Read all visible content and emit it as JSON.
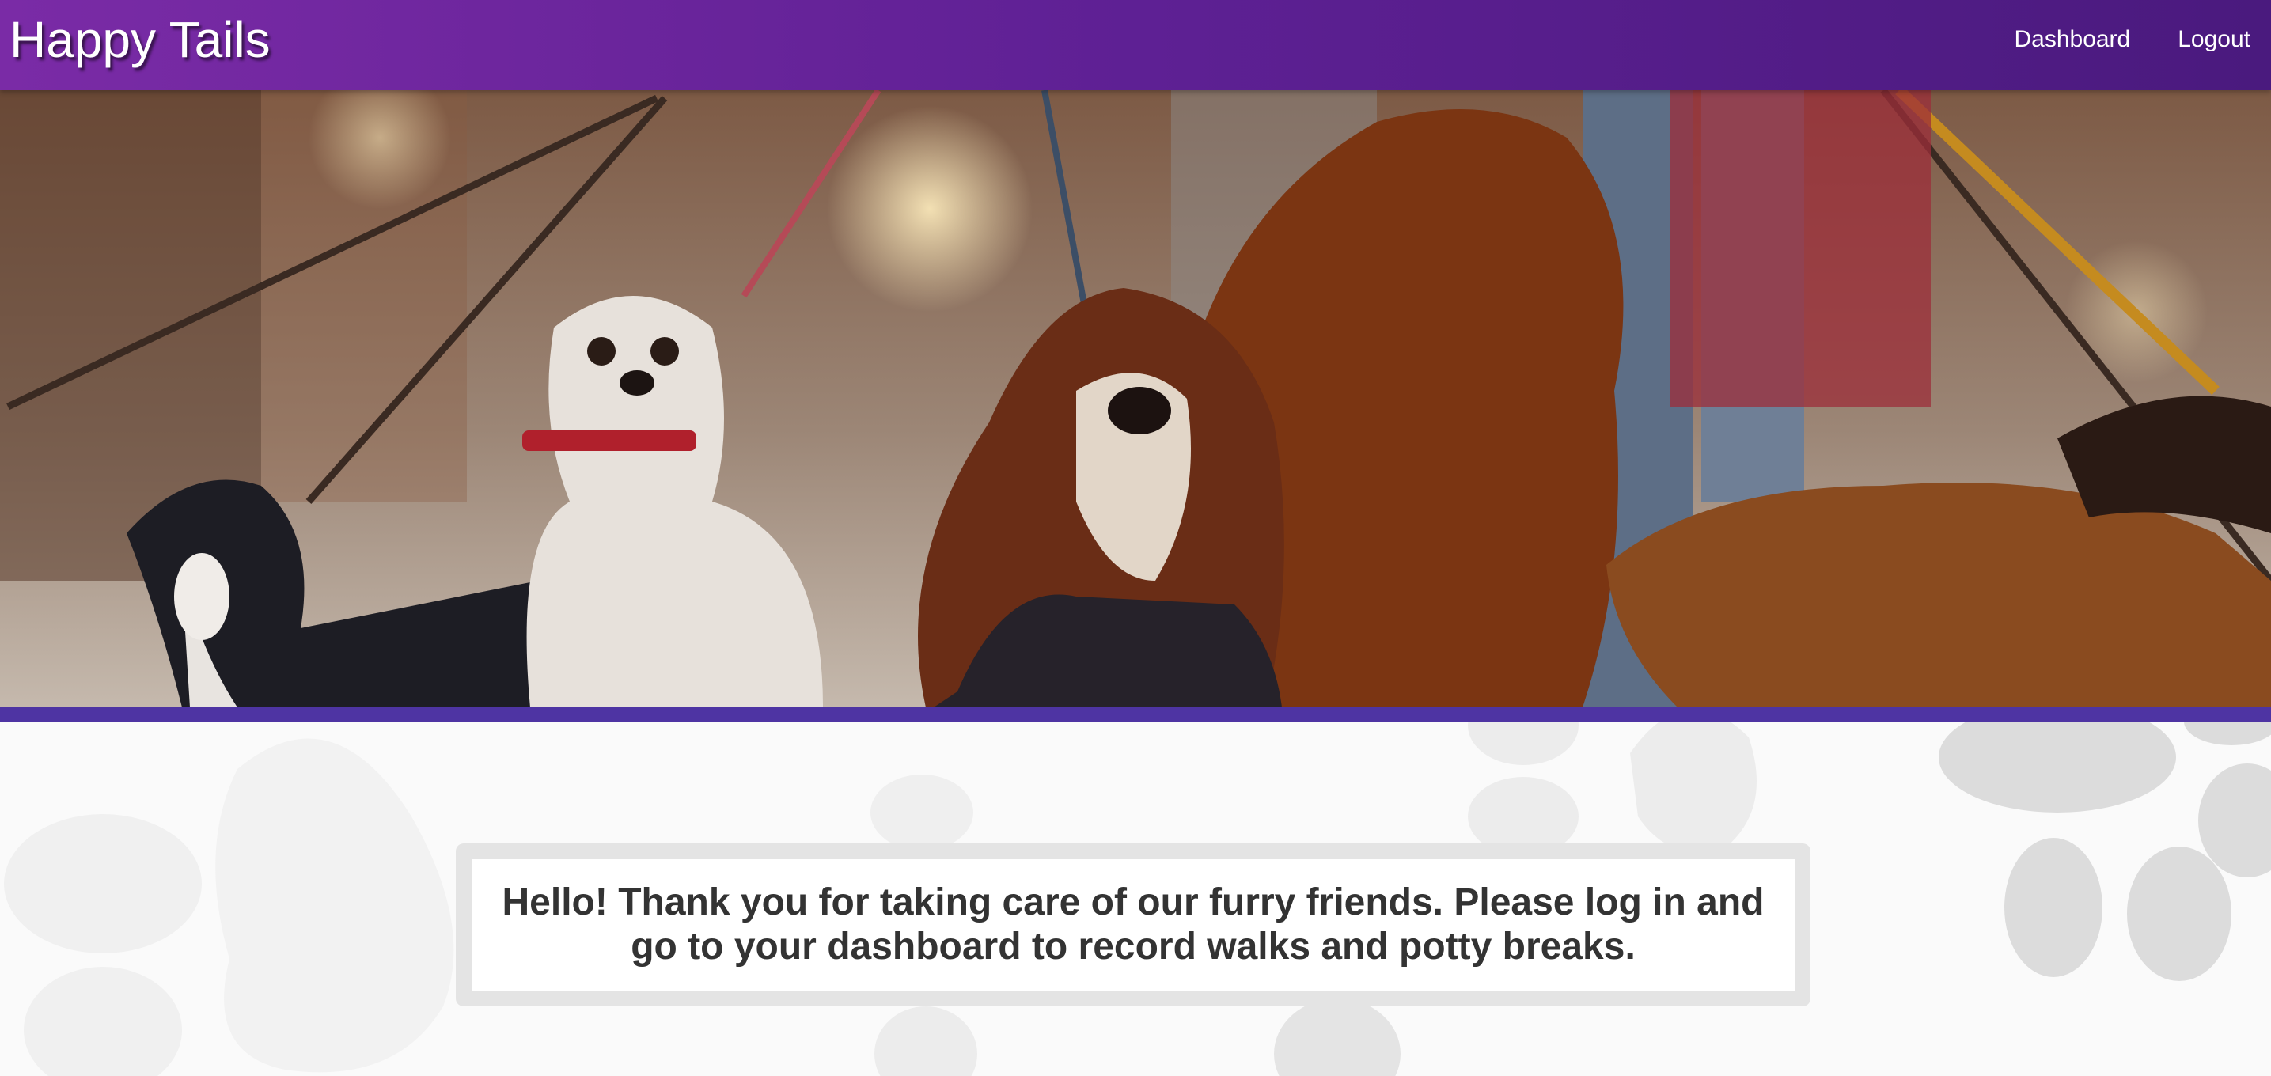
{
  "navbar": {
    "brand": "Happy Tails",
    "links": [
      {
        "label": "Dashboard"
      },
      {
        "label": "Logout"
      }
    ]
  },
  "hero": {
    "image": "dogs-on-leashes-photo",
    "accent_color": "#4e34a3"
  },
  "main": {
    "message": "Hello! Thank you for taking care of our furry friends. Please log in and go to your dashboard to record walks and potty breaks."
  },
  "colors": {
    "nav_gradient_start": "#7a2ba6",
    "nav_gradient_end": "#4a1a7e",
    "text_dark": "#333333",
    "box_border": "#e4e4e4",
    "paw_print": "#e8e8e8"
  }
}
